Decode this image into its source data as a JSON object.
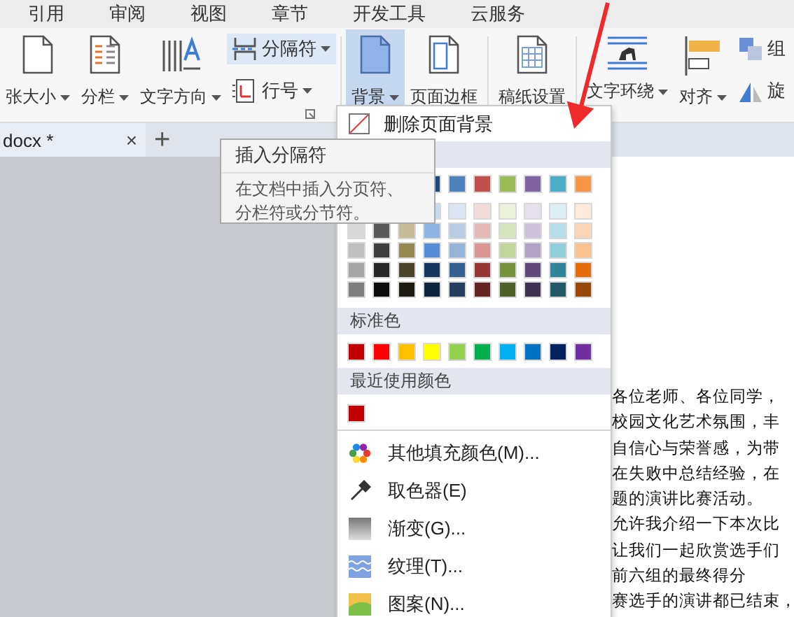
{
  "menu_tabs": [
    {
      "label": "引用"
    },
    {
      "label": "审阅"
    },
    {
      "label": "视图"
    },
    {
      "label": "章节"
    },
    {
      "label": "开发工具"
    },
    {
      "label": "云服务"
    }
  ],
  "ribbon": {
    "items": [
      {
        "label": "张大小",
        "dropdown": true,
        "selected": false,
        "hovered": false
      },
      {
        "label": "分栏",
        "dropdown": true,
        "selected": false,
        "hovered": false
      },
      {
        "label": "文字方向",
        "dropdown": true,
        "selected": false,
        "hovered": false
      },
      {
        "label": "分隔符",
        "dropdown": true,
        "selected": false,
        "hovered": true
      },
      {
        "label": "行号",
        "dropdown": true,
        "selected": false,
        "hovered": false
      },
      {
        "label": "背景",
        "dropdown": true,
        "selected": true,
        "hovered": false
      },
      {
        "label": "页面边框",
        "dropdown": false,
        "selected": false,
        "hovered": false
      },
      {
        "label": "稿纸设置",
        "dropdown": false,
        "selected": false,
        "hovered": false
      },
      {
        "label": "文字环绕",
        "dropdown": true,
        "selected": false,
        "hovered": false
      },
      {
        "label": "对齐",
        "dropdown": true,
        "selected": false,
        "hovered": false
      },
      {
        "label": "组",
        "dropdown": false,
        "selected": false,
        "hovered": false
      },
      {
        "label": "旋",
        "dropdown": false,
        "selected": false,
        "hovered": false
      }
    ]
  },
  "doc_tabs": [
    {
      "label": "docx *",
      "close": "×"
    }
  ],
  "new_tab": "+",
  "tooltip": {
    "title": "插入分隔符",
    "body": [
      "在文档中插入分页符、",
      "分栏符或分节符。"
    ]
  },
  "background_menu": {
    "remove": "删除页面背景",
    "theme_top": [
      {
        "color": "#1f497d"
      },
      {
        "color": "#4f81bd"
      },
      {
        "color": "#c0504d"
      },
      {
        "color": "#9bbb59"
      },
      {
        "color": "#8064a2"
      },
      {
        "color": "#4bacc6"
      },
      {
        "color": "#f79646"
      }
    ],
    "theme_shades": [
      {
        "swatches": [
          {
            "color": "#c6d9f0"
          },
          {
            "color": "#dbe5f1"
          },
          {
            "color": "#f2dcdb"
          },
          {
            "color": "#ebf1dd"
          },
          {
            "color": "#e5e0ec"
          },
          {
            "color": "#dbeef3"
          },
          {
            "color": "#fdeada"
          }
        ]
      },
      {
        "swatches": [
          {
            "color": "#d8d8d8"
          },
          {
            "color": "#595959"
          },
          {
            "color": "#c4bd97"
          },
          {
            "color": "#8db3e2"
          },
          {
            "color": "#b8cce4"
          },
          {
            "color": "#e5b9b7"
          },
          {
            "color": "#d7e3bc"
          },
          {
            "color": "#ccc1d9"
          },
          {
            "color": "#b7dde8"
          },
          {
            "color": "#fbd5b5"
          }
        ]
      },
      {
        "swatches": [
          {
            "color": "#bfbfbf"
          },
          {
            "color": "#3f3f3f"
          },
          {
            "color": "#938953"
          },
          {
            "color": "#548dd4"
          },
          {
            "color": "#95b3d7"
          },
          {
            "color": "#d99694"
          },
          {
            "color": "#c3d69b"
          },
          {
            "color": "#b2a2c7"
          },
          {
            "color": "#92cddc"
          },
          {
            "color": "#fac08f"
          }
        ]
      },
      {
        "swatches": [
          {
            "color": "#a5a5a5"
          },
          {
            "color": "#262626"
          },
          {
            "color": "#494429"
          },
          {
            "color": "#17365d"
          },
          {
            "color": "#366092"
          },
          {
            "color": "#953734"
          },
          {
            "color": "#76923c"
          },
          {
            "color": "#5f497a"
          },
          {
            "color": "#31859b"
          },
          {
            "color": "#e36c09"
          }
        ]
      },
      {
        "swatches": [
          {
            "color": "#7f7f7f"
          },
          {
            "color": "#0c0c0c"
          },
          {
            "color": "#1d1b10"
          },
          {
            "color": "#0f243e"
          },
          {
            "color": "#244061"
          },
          {
            "color": "#632423"
          },
          {
            "color": "#4f6128"
          },
          {
            "color": "#3f3151"
          },
          {
            "color": "#205867"
          },
          {
            "color": "#974806"
          }
        ]
      }
    ],
    "standard_label": "标准色",
    "standard": [
      {
        "color": "#c00000"
      },
      {
        "color": "#ff0000"
      },
      {
        "color": "#ffc000"
      },
      {
        "color": "#ffff00"
      },
      {
        "color": "#92d050"
      },
      {
        "color": "#00b050"
      },
      {
        "color": "#00b0f0"
      },
      {
        "color": "#0070c0"
      },
      {
        "color": "#002060"
      },
      {
        "color": "#7030a0"
      }
    ],
    "recent_label": "最近使用颜色",
    "recent": [
      {
        "color": "#c00000"
      }
    ],
    "items": [
      {
        "label": "其他填充颜色(M)..."
      },
      {
        "label": "取色器(E)"
      },
      {
        "label": "渐变(G)..."
      },
      {
        "label": "纹理(T)..."
      },
      {
        "label": "图案(N)..."
      }
    ]
  },
  "document_lines": [
    "各位老师、各位同学，",
    "校园文化艺术氛围，丰",
    "自信心与荣誉感，为带",
    "在失败中总结经验，在",
    "题的演讲比赛活动。",
    "允许我介绍一下本次比",
    "让我们一起欣赏选手们",
    "前六组的最终得分",
    "赛选手的演讲都已结束，"
  ]
}
